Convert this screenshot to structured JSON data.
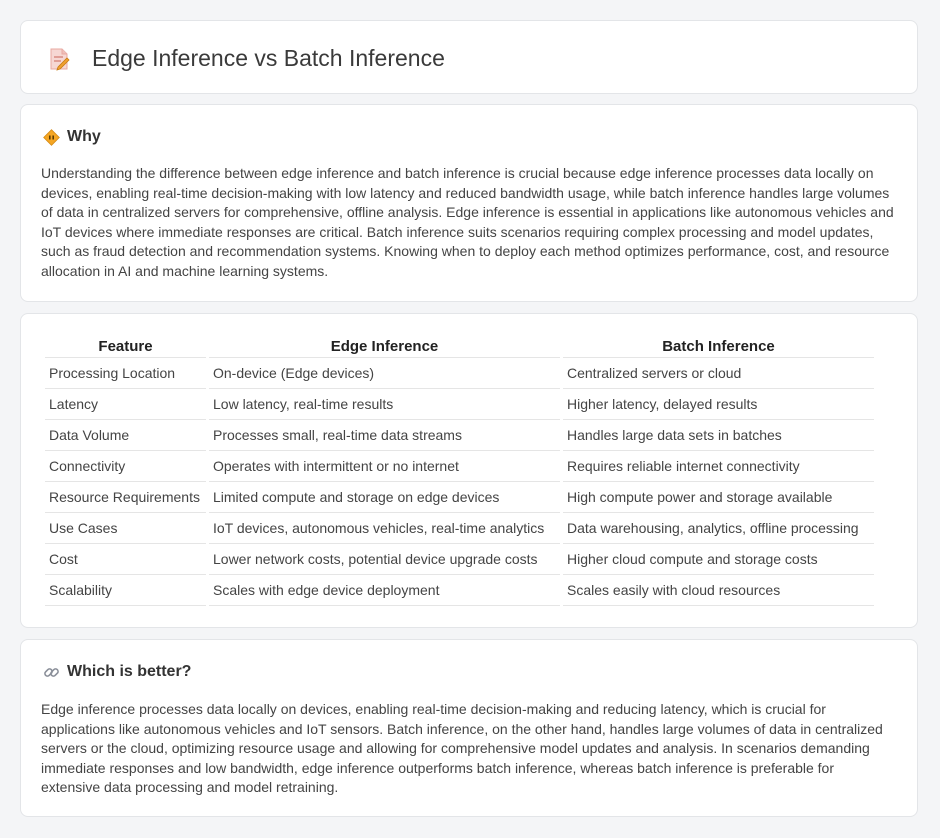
{
  "header": {
    "title": "Edge Inference vs Batch Inference",
    "icon": "document-edit-icon"
  },
  "why": {
    "heading": "Why",
    "icon": "diamond-sign-icon",
    "body": "Understanding the difference between edge inference and batch inference is crucial because edge inference processes data locally on devices, enabling real-time decision-making with low latency and reduced bandwidth usage, while batch inference handles large volumes of data in centralized servers for comprehensive, offline analysis. Edge inference is essential in applications like autonomous vehicles and IoT devices where immediate responses are critical. Batch inference suits scenarios requiring complex processing and model updates, such as fraud detection and recommendation systems. Knowing when to deploy each method optimizes performance, cost, and resource allocation in AI and machine learning systems."
  },
  "table": {
    "headers": [
      "Feature",
      "Edge Inference",
      "Batch Inference"
    ],
    "rows": [
      [
        "Processing Location",
        "On-device (Edge devices)",
        "Centralized servers or cloud"
      ],
      [
        "Latency",
        "Low latency, real-time results",
        "Higher latency, delayed results"
      ],
      [
        "Data Volume",
        "Processes small, real-time data streams",
        "Handles large data sets in batches"
      ],
      [
        "Connectivity",
        "Operates with intermittent or no internet",
        "Requires reliable internet connectivity"
      ],
      [
        "Resource Requirements",
        "Limited compute and storage on edge devices",
        "High compute power and storage available"
      ],
      [
        "Use Cases",
        "IoT devices, autonomous vehicles, real-time analytics",
        "Data warehousing, analytics, offline processing"
      ],
      [
        "Cost",
        "Lower network costs, potential device upgrade costs",
        "Higher cloud compute and storage costs"
      ],
      [
        "Scalability",
        "Scales with edge device deployment",
        "Scales easily with cloud resources"
      ]
    ]
  },
  "better": {
    "heading": "Which is better?",
    "icon": "link-icon",
    "body": "Edge inference processes data locally on devices, enabling real-time decision-making and reducing latency, which is crucial for applications like autonomous vehicles and IoT sensors. Batch inference, on the other hand, handles large volumes of data in centralized servers or the cloud, optimizing resource usage and allowing for comprehensive model updates and analysis. In scenarios demanding immediate responses and low bandwidth, edge inference outperforms batch inference, whereas batch inference is preferable for extensive data processing and model retraining."
  },
  "colors": {
    "background": "#f4f5f7",
    "card": "#ffffff",
    "accent_orange": "#f0a030",
    "icon_pink": "#e07a7a"
  }
}
